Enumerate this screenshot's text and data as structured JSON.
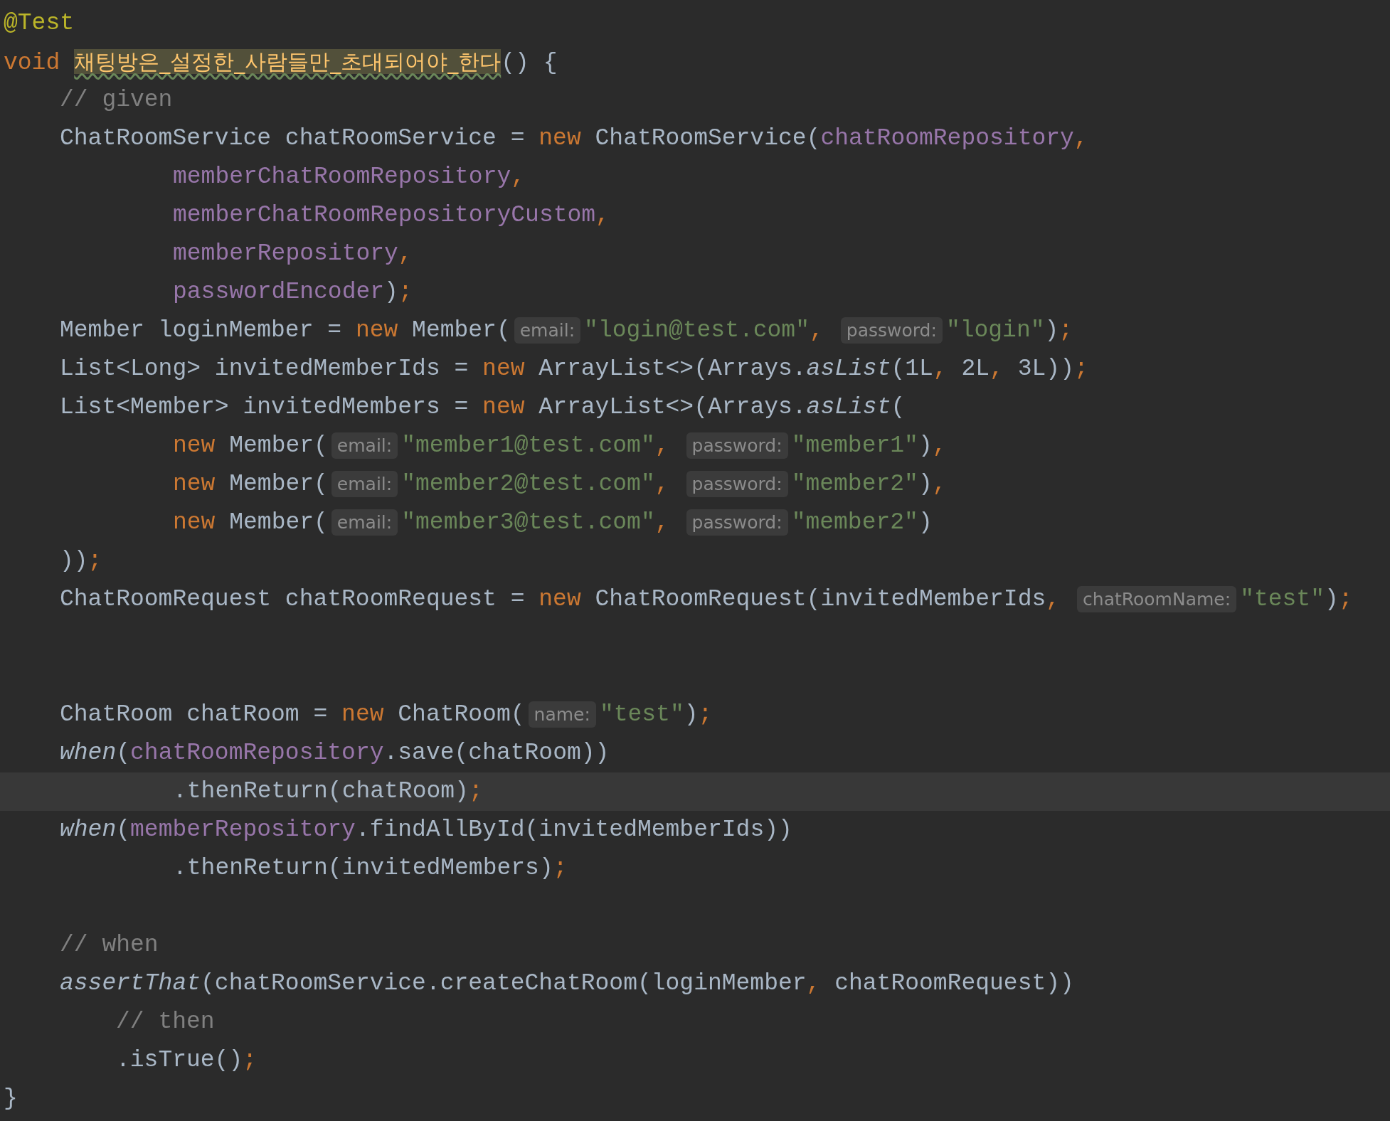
{
  "editor": {
    "lines": [
      {
        "kind": "top",
        "highlighted": false,
        "tokens": [
          {
            "kind": "annotation",
            "text": "@Test"
          }
        ]
      },
      {
        "kind": "top",
        "highlighted": false,
        "tokens": [
          {
            "kind": "keyword",
            "text": "void"
          },
          {
            "kind": "method",
            "text": "채팅방은_설정한_사람들만_초대되어야_한다"
          },
          {
            "kind": "plain",
            "text": "() {"
          }
        ]
      },
      {
        "kind": "body",
        "highlighted": false,
        "tokens": [
          {
            "kind": "comment",
            "text": "// given"
          }
        ]
      },
      {
        "kind": "body",
        "highlighted": false,
        "tokens": [
          {
            "kind": "plain",
            "text": "ChatRoomService chatRoomService = "
          },
          {
            "kind": "keyword",
            "text": "new"
          },
          {
            "kind": "plain",
            "text": " ChatRoomService("
          },
          {
            "kind": "field",
            "text": "chatRoomRepository"
          },
          {
            "kind": "punct",
            "text": ","
          }
        ]
      },
      {
        "kind": "wrap",
        "highlighted": false,
        "tokens": [
          {
            "kind": "field",
            "text": "memberChatRoomRepository"
          },
          {
            "kind": "punct",
            "text": ","
          }
        ]
      },
      {
        "kind": "wrap",
        "highlighted": false,
        "tokens": [
          {
            "kind": "field",
            "text": "memberChatRoomRepositoryCustom"
          },
          {
            "kind": "punct",
            "text": ","
          }
        ]
      },
      {
        "kind": "wrap",
        "highlighted": false,
        "tokens": [
          {
            "kind": "field",
            "text": "memberRepository"
          },
          {
            "kind": "punct",
            "text": ","
          }
        ]
      },
      {
        "kind": "wrap",
        "highlighted": false,
        "tokens": [
          {
            "kind": "field",
            "text": "passwordEncoder"
          },
          {
            "kind": "plain",
            "text": ")"
          },
          {
            "kind": "punct",
            "text": ";"
          }
        ]
      },
      {
        "kind": "body",
        "highlighted": false,
        "tokens": [
          {
            "kind": "plain",
            "text": "Member loginMember = "
          },
          {
            "kind": "keyword",
            "text": "new"
          },
          {
            "kind": "plain",
            "text": " Member("
          },
          {
            "kind": "hint",
            "text": "email:"
          },
          {
            "kind": "string",
            "text": "\"login@test.com\""
          },
          {
            "kind": "punct",
            "text": ","
          },
          {
            "kind": "hint",
            "text": "password:"
          },
          {
            "kind": "string",
            "text": "\"login\""
          },
          {
            "kind": "plain",
            "text": ")"
          },
          {
            "kind": "punct",
            "text": ";"
          }
        ]
      },
      {
        "kind": "body",
        "highlighted": false,
        "tokens": [
          {
            "kind": "plain",
            "text": "List<Long> invitedMemberIds = "
          },
          {
            "kind": "keyword",
            "text": "new"
          },
          {
            "kind": "plain",
            "text": " ArrayList<>(Arrays."
          },
          {
            "kind": "italic",
            "text": "asList"
          },
          {
            "kind": "plain",
            "text": "("
          },
          {
            "kind": "number",
            "text": "1L"
          },
          {
            "kind": "punct",
            "text": ","
          },
          {
            "kind": "number",
            "text": " 2L"
          },
          {
            "kind": "punct",
            "text": ","
          },
          {
            "kind": "number",
            "text": " 3L"
          },
          {
            "kind": "plain",
            "text": "))"
          },
          {
            "kind": "punct",
            "text": ";"
          }
        ]
      },
      {
        "kind": "body",
        "highlighted": false,
        "tokens": [
          {
            "kind": "plain",
            "text": "List<Member> invitedMembers = "
          },
          {
            "kind": "keyword",
            "text": "new"
          },
          {
            "kind": "plain",
            "text": " ArrayList<>(Arrays."
          },
          {
            "kind": "italic",
            "text": "asList"
          },
          {
            "kind": "plain",
            "text": "("
          }
        ]
      },
      {
        "kind": "wrap",
        "highlighted": false,
        "tokens": [
          {
            "kind": "keyword",
            "text": "new"
          },
          {
            "kind": "plain",
            "text": " Member("
          },
          {
            "kind": "hint",
            "text": "email:"
          },
          {
            "kind": "string",
            "text": "\"member1@test.com\""
          },
          {
            "kind": "punct",
            "text": ","
          },
          {
            "kind": "hint",
            "text": "password:"
          },
          {
            "kind": "string",
            "text": "\"member1\""
          },
          {
            "kind": "plain",
            "text": ")"
          },
          {
            "kind": "punct",
            "text": ","
          }
        ]
      },
      {
        "kind": "wrap",
        "highlighted": false,
        "tokens": [
          {
            "kind": "keyword",
            "text": "new"
          },
          {
            "kind": "plain",
            "text": " Member("
          },
          {
            "kind": "hint",
            "text": "email:"
          },
          {
            "kind": "string",
            "text": "\"member2@test.com\""
          },
          {
            "kind": "punct",
            "text": ","
          },
          {
            "kind": "hint",
            "text": "password:"
          },
          {
            "kind": "string",
            "text": "\"member2\""
          },
          {
            "kind": "plain",
            "text": ")"
          },
          {
            "kind": "punct",
            "text": ","
          }
        ]
      },
      {
        "kind": "wrap",
        "highlighted": false,
        "tokens": [
          {
            "kind": "keyword",
            "text": "new"
          },
          {
            "kind": "plain",
            "text": " Member("
          },
          {
            "kind": "hint",
            "text": "email:"
          },
          {
            "kind": "string",
            "text": "\"member3@test.com\""
          },
          {
            "kind": "punct",
            "text": ","
          },
          {
            "kind": "hint",
            "text": "password:"
          },
          {
            "kind": "string",
            "text": "\"member2\""
          },
          {
            "kind": "plain",
            "text": ")"
          }
        ]
      },
      {
        "kind": "body",
        "highlighted": false,
        "tokens": [
          {
            "kind": "plain",
            "text": "))"
          },
          {
            "kind": "punct",
            "text": ";"
          }
        ]
      },
      {
        "kind": "body",
        "highlighted": false,
        "tokens": [
          {
            "kind": "plain",
            "text": "ChatRoomRequest chatRoomRequest = "
          },
          {
            "kind": "keyword",
            "text": "new"
          },
          {
            "kind": "plain",
            "text": " ChatRoomRequest(invitedMemberIds"
          },
          {
            "kind": "punct",
            "text": ","
          },
          {
            "kind": "hint",
            "text": "chatRoomName:"
          },
          {
            "kind": "string",
            "text": "\"test\""
          },
          {
            "kind": "plain",
            "text": ")"
          },
          {
            "kind": "punct",
            "text": ";"
          }
        ]
      },
      {
        "kind": "blank",
        "highlighted": false
      },
      {
        "kind": "blank",
        "highlighted": false
      },
      {
        "kind": "body",
        "highlighted": false,
        "tokens": [
          {
            "kind": "plain",
            "text": "ChatRoom chatRoom = "
          },
          {
            "kind": "keyword",
            "text": "new"
          },
          {
            "kind": "plain",
            "text": " ChatRoom("
          },
          {
            "kind": "hint",
            "text": "name:"
          },
          {
            "kind": "string",
            "text": "\"test\""
          },
          {
            "kind": "plain",
            "text": ")"
          },
          {
            "kind": "punct",
            "text": ";"
          }
        ]
      },
      {
        "kind": "body",
        "highlighted": false,
        "tokens": [
          {
            "kind": "italic",
            "text": "when"
          },
          {
            "kind": "plain",
            "text": "("
          },
          {
            "kind": "field",
            "text": "chatRoomRepository"
          },
          {
            "kind": "plain",
            "text": ".save(chatRoom))"
          }
        ]
      },
      {
        "kind": "wrap",
        "highlighted": true,
        "tokens": [
          {
            "kind": "plain",
            "text": ".thenReturn(chatRoom)"
          },
          {
            "kind": "punct",
            "text": ";"
          }
        ]
      },
      {
        "kind": "body",
        "highlighted": false,
        "tokens": [
          {
            "kind": "italic",
            "text": "when"
          },
          {
            "kind": "plain",
            "text": "("
          },
          {
            "kind": "field",
            "text": "memberRepository"
          },
          {
            "kind": "plain",
            "text": ".findAllById(invitedMemberIds))"
          }
        ]
      },
      {
        "kind": "wrap",
        "highlighted": false,
        "tokens": [
          {
            "kind": "plain",
            "text": ".thenReturn(invitedMembers)"
          },
          {
            "kind": "punct",
            "text": ";"
          }
        ]
      },
      {
        "kind": "blank",
        "highlighted": false
      },
      {
        "kind": "body",
        "highlighted": false,
        "tokens": [
          {
            "kind": "comment",
            "text": "// when"
          }
        ]
      },
      {
        "kind": "body",
        "highlighted": false,
        "tokens": [
          {
            "kind": "italic",
            "text": "assertThat"
          },
          {
            "kind": "plain",
            "text": "(chatRoomService.createChatRoom(loginMember"
          },
          {
            "kind": "punct",
            "text": ","
          },
          {
            "kind": "plain",
            "text": " chatRoomRequest))"
          }
        ]
      },
      {
        "kind": "nested",
        "highlighted": false,
        "tokens": [
          {
            "kind": "comment",
            "text": "// then"
          }
        ]
      },
      {
        "kind": "nested",
        "highlighted": false,
        "tokens": [
          {
            "kind": "plain",
            "text": ".isTrue()"
          },
          {
            "kind": "punct",
            "text": ";"
          }
        ]
      },
      {
        "kind": "top",
        "highlighted": false,
        "tokens": [
          {
            "kind": "plain",
            "text": "}"
          }
        ]
      }
    ]
  }
}
